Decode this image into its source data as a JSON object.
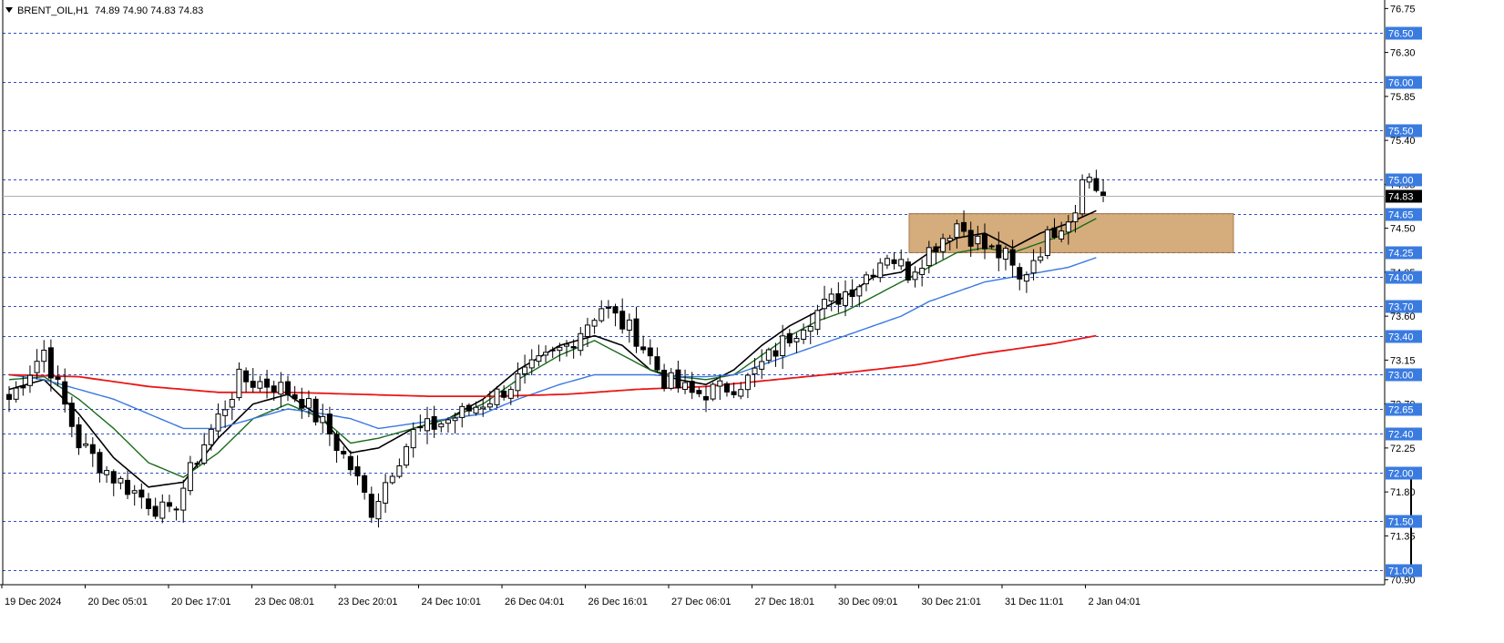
{
  "header": {
    "symbol_label": "BRENT_OIL,H1",
    "ohlc_label": "74.89 74.90 74.83 74.83"
  },
  "icons": {
    "dropdown": "triangle-down-icon"
  },
  "colors": {
    "candle_up_fill": "#ffffff",
    "candle_down_fill": "#000000",
    "ema_black": "#000000",
    "ema_green": "#1a6b1a",
    "ema_blue": "#3a78e0",
    "ema_red": "#e81818",
    "level_line": "#2a4fc9",
    "level_label_bg": "#3a7be0",
    "zone_fill": "#d2a570",
    "current_price_bg": "#000000"
  },
  "chart_data": {
    "type": "candlestick",
    "symbol": "BRENT_OIL",
    "timeframe": "H1",
    "ylim": [
      70.9,
      76.75
    ],
    "y_ticks": [
      76.75,
      76.3,
      75.85,
      75.4,
      74.95,
      74.5,
      74.05,
      73.6,
      73.15,
      72.7,
      72.25,
      71.8,
      71.35,
      70.9
    ],
    "x_ticks": [
      "19 Dec 2024",
      "20 Dec 05:01",
      "20 Dec 17:01",
      "23 Dec 08:01",
      "23 Dec 20:01",
      "24 Dec 10:01",
      "26 Dec 04:01",
      "26 Dec 16:01",
      "27 Dec 06:01",
      "27 Dec 18:01",
      "30 Dec 09:01",
      "30 Dec 21:01",
      "31 Dec 11:01",
      "2 Jan 04:01"
    ],
    "horizontal_levels": [
      "76.50",
      "76.00",
      "75.50",
      "75.00",
      "74.65",
      "74.25",
      "74.00",
      "73.70",
      "73.40",
      "73.00",
      "72.65",
      "72.40",
      "72.00",
      "71.50",
      "71.00"
    ],
    "current_price": "74.83",
    "zone": {
      "low": 74.25,
      "high": 74.65,
      "start_label": "30 Dec 21:01"
    },
    "close_path": [
      [
        0,
        72.75
      ],
      [
        5,
        73.25
      ],
      [
        10,
        72.3
      ],
      [
        15,
        71.95
      ],
      [
        19,
        71.75
      ],
      [
        23,
        71.55
      ],
      [
        28,
        72.3
      ],
      [
        33,
        72.95
      ],
      [
        38,
        72.9
      ],
      [
        42,
        72.75
      ],
      [
        46,
        72.4
      ],
      [
        49,
        72.05
      ],
      [
        52,
        71.62
      ],
      [
        55,
        72.05
      ],
      [
        58,
        72.4
      ],
      [
        60,
        72.45
      ],
      [
        65,
        72.6
      ],
      [
        70,
        72.8
      ],
      [
        75,
        73.05
      ],
      [
        80,
        73.3
      ],
      [
        85,
        73.7
      ],
      [
        90,
        73.4
      ],
      [
        94,
        72.95
      ],
      [
        98,
        72.8
      ],
      [
        102,
        72.85
      ],
      [
        106,
        72.95
      ],
      [
        110,
        73.25
      ],
      [
        114,
        73.55
      ],
      [
        118,
        73.75
      ],
      [
        122,
        73.95
      ],
      [
        126,
        74.25
      ],
      [
        129,
        74.05
      ],
      [
        133,
        74.35
      ],
      [
        136,
        74.55
      ],
      [
        140,
        74.3
      ],
      [
        143,
        74.2
      ],
      [
        145,
        73.95
      ],
      [
        147,
        74.2
      ],
      [
        150,
        74.5
      ],
      [
        153,
        74.7
      ],
      [
        154,
        75.1
      ],
      [
        155,
        75.0
      ],
      [
        156,
        74.9
      ],
      [
        157,
        74.83
      ]
    ],
    "series": [
      {
        "name": "EMA black",
        "period_hint": "fast",
        "values": [
          [
            0,
            72.85
          ],
          [
            5,
            72.95
          ],
          [
            10,
            72.6
          ],
          [
            15,
            72.15
          ],
          [
            20,
            71.85
          ],
          [
            25,
            71.9
          ],
          [
            30,
            72.35
          ],
          [
            35,
            72.7
          ],
          [
            40,
            72.8
          ],
          [
            45,
            72.55
          ],
          [
            49,
            72.2
          ],
          [
            53,
            72.25
          ],
          [
            58,
            72.45
          ],
          [
            63,
            72.55
          ],
          [
            68,
            72.75
          ],
          [
            73,
            73.05
          ],
          [
            79,
            73.3
          ],
          [
            84,
            73.4
          ],
          [
            88,
            73.3
          ],
          [
            92,
            73.05
          ],
          [
            96,
            72.95
          ],
          [
            100,
            72.9
          ],
          [
            104,
            73.05
          ],
          [
            108,
            73.3
          ],
          [
            112,
            73.5
          ],
          [
            116,
            73.65
          ],
          [
            120,
            73.8
          ],
          [
            124,
            74.0
          ],
          [
            128,
            74.05
          ],
          [
            132,
            74.25
          ],
          [
            136,
            74.4
          ],
          [
            140,
            74.45
          ],
          [
            144,
            74.3
          ],
          [
            148,
            74.45
          ],
          [
            152,
            74.55
          ],
          [
            156,
            74.68
          ]
        ]
      },
      {
        "name": "EMA green",
        "period_hint": "medium",
        "values": [
          [
            0,
            72.95
          ],
          [
            5,
            72.98
          ],
          [
            10,
            72.75
          ],
          [
            15,
            72.45
          ],
          [
            20,
            72.1
          ],
          [
            25,
            71.95
          ],
          [
            30,
            72.2
          ],
          [
            35,
            72.55
          ],
          [
            40,
            72.7
          ],
          [
            45,
            72.55
          ],
          [
            49,
            72.3
          ],
          [
            53,
            72.35
          ],
          [
            58,
            72.45
          ],
          [
            63,
            72.55
          ],
          [
            68,
            72.7
          ],
          [
            73,
            72.95
          ],
          [
            79,
            73.2
          ],
          [
            84,
            73.35
          ],
          [
            88,
            73.2
          ],
          [
            92,
            73.05
          ],
          [
            96,
            72.98
          ],
          [
            100,
            72.95
          ],
          [
            104,
            73.0
          ],
          [
            108,
            73.2
          ],
          [
            112,
            73.4
          ],
          [
            116,
            73.55
          ],
          [
            120,
            73.65
          ],
          [
            124,
            73.8
          ],
          [
            128,
            73.95
          ],
          [
            132,
            74.1
          ],
          [
            136,
            74.25
          ],
          [
            140,
            74.3
          ],
          [
            144,
            74.25
          ],
          [
            148,
            74.35
          ],
          [
            152,
            74.45
          ],
          [
            156,
            74.6
          ]
        ]
      },
      {
        "name": "EMA blue",
        "period_hint": "slow",
        "values": [
          [
            0,
            73.0
          ],
          [
            5,
            72.95
          ],
          [
            10,
            72.85
          ],
          [
            15,
            72.75
          ],
          [
            20,
            72.6
          ],
          [
            25,
            72.45
          ],
          [
            30,
            72.45
          ],
          [
            35,
            72.55
          ],
          [
            40,
            72.65
          ],
          [
            45,
            72.6
          ],
          [
            49,
            72.55
          ],
          [
            53,
            72.45
          ],
          [
            58,
            72.5
          ],
          [
            63,
            72.55
          ],
          [
            68,
            72.6
          ],
          [
            73,
            72.75
          ],
          [
            79,
            72.9
          ],
          [
            84,
            73.0
          ],
          [
            88,
            73.0
          ],
          [
            92,
            73.0
          ],
          [
            96,
            72.98
          ],
          [
            100,
            72.98
          ],
          [
            104,
            73.0
          ],
          [
            108,
            73.1
          ],
          [
            112,
            73.2
          ],
          [
            116,
            73.3
          ],
          [
            120,
            73.4
          ],
          [
            124,
            73.5
          ],
          [
            128,
            73.6
          ],
          [
            132,
            73.75
          ],
          [
            136,
            73.85
          ],
          [
            140,
            73.95
          ],
          [
            144,
            74.0
          ],
          [
            148,
            74.05
          ],
          [
            152,
            74.1
          ],
          [
            156,
            74.2
          ]
        ]
      },
      {
        "name": "EMA red",
        "period_hint": "slowest",
        "values": [
          [
            0,
            73.0
          ],
          [
            10,
            72.98
          ],
          [
            20,
            72.88
          ],
          [
            30,
            72.82
          ],
          [
            40,
            72.82
          ],
          [
            50,
            72.8
          ],
          [
            60,
            72.78
          ],
          [
            70,
            72.78
          ],
          [
            80,
            72.8
          ],
          [
            90,
            72.85
          ],
          [
            100,
            72.88
          ],
          [
            110,
            72.95
          ],
          [
            120,
            73.02
          ],
          [
            130,
            73.1
          ],
          [
            140,
            73.22
          ],
          [
            150,
            73.32
          ],
          [
            156,
            73.4
          ]
        ]
      }
    ]
  }
}
